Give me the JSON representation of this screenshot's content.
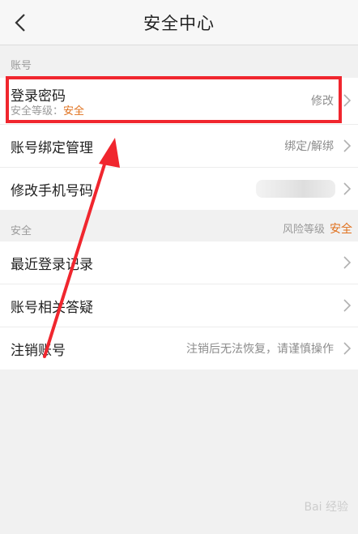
{
  "header": {
    "title": "安全中心"
  },
  "account_section": {
    "label": "账号"
  },
  "password_row": {
    "title": "登录密码",
    "level_label": "安全等级：",
    "level_value": "安全",
    "action": "修改"
  },
  "binding_row": {
    "title": "账号绑定管理",
    "value": "绑定/解绑"
  },
  "phone_row": {
    "title": "修改手机号码"
  },
  "security_section": {
    "label": "安全",
    "risk_label": "风险等级",
    "risk_value": "安全"
  },
  "recent_login_row": {
    "title": "最近登录记录"
  },
  "faq_row": {
    "title": "账号相关答疑"
  },
  "cancel_row": {
    "title": "注销账号",
    "value": "注销后无法恢复，请谨慎操作"
  },
  "watermark": {
    "text": "Bai 经验"
  },
  "colors": {
    "accent": "#e0701c",
    "annotation": "#f0262e"
  }
}
